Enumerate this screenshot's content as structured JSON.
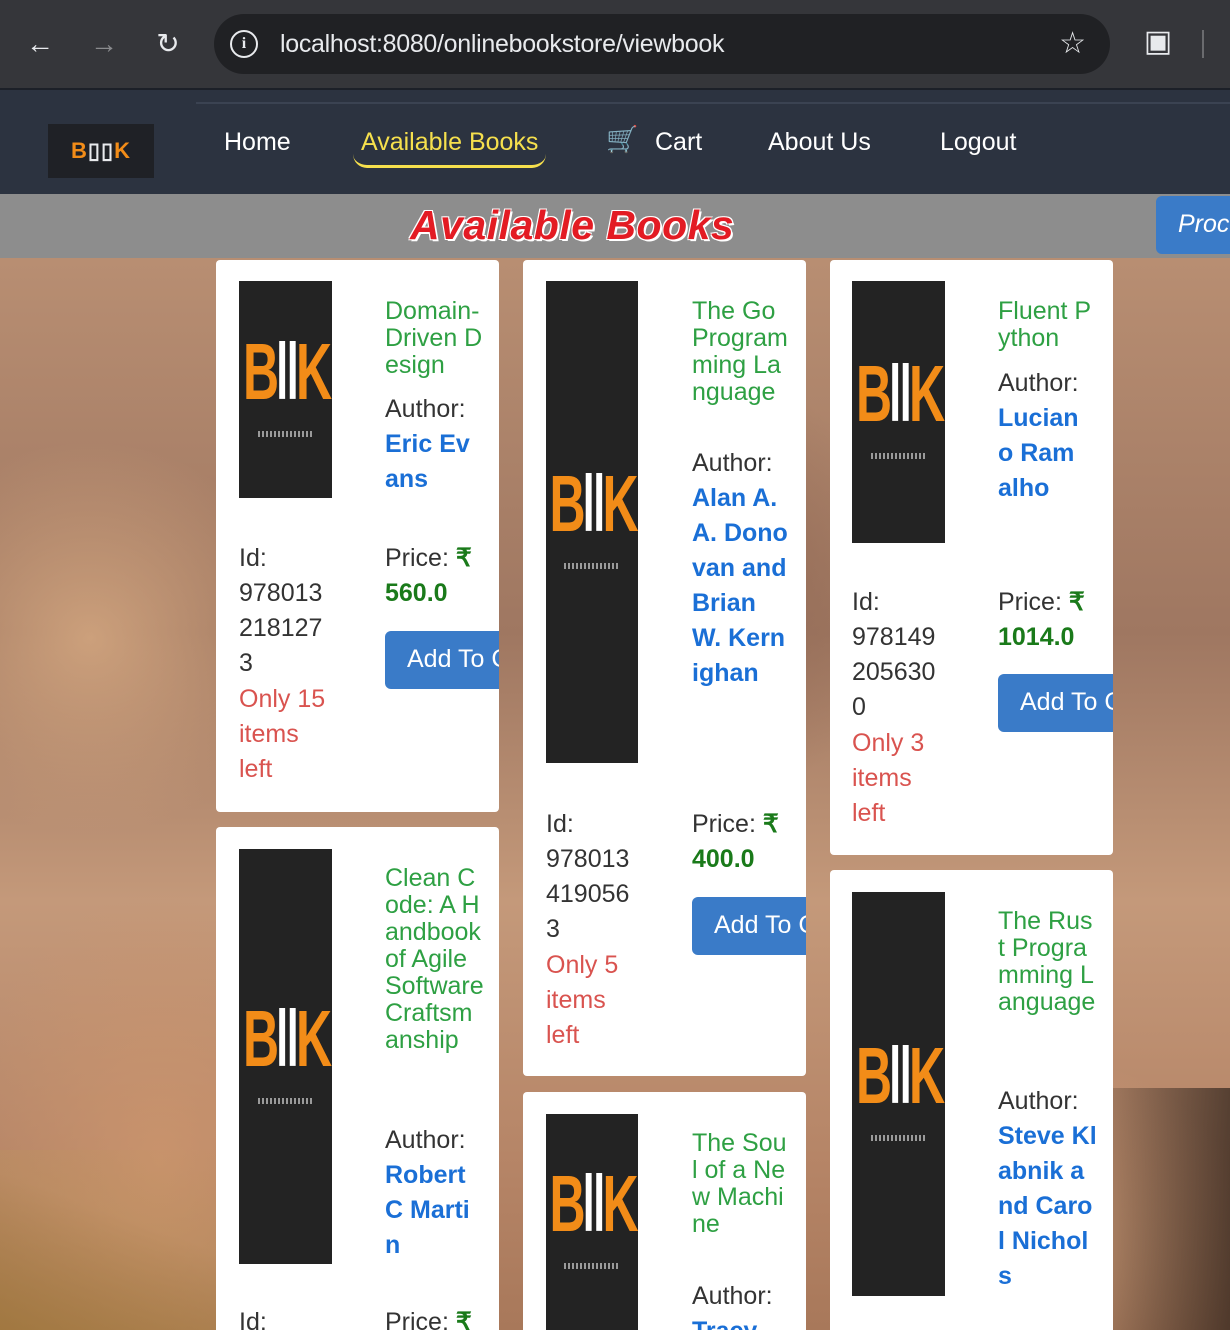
{
  "browser": {
    "url": "localhost:8080/onlinebookstore/viewbook",
    "icons": {
      "back": "arrow-left-icon",
      "forward": "arrow-right-icon",
      "reload": "reload-icon",
      "info": "info-icon",
      "bookmark": "star-icon",
      "extensions": "puzzle-icon"
    }
  },
  "navbar": {
    "logo_text": "BOOK",
    "items": [
      {
        "label": "Home"
      },
      {
        "label": "Available Books",
        "active": true
      },
      {
        "label": "Cart",
        "icon": "cart-icon"
      },
      {
        "label": "About Us"
      },
      {
        "label": "Logout"
      }
    ]
  },
  "heading": {
    "title": "Available Books",
    "proceed_label": "Proceed"
  },
  "books": [
    {
      "title": "Domain-Driven Design",
      "author_label": "Author:",
      "author": "Eric Evans",
      "id_label": "Id:",
      "id": "9780132181273",
      "stock": "Only 15 items left",
      "price_label": "Price:",
      "currency": "₹",
      "price": "560.0",
      "button": "Add To Cart"
    },
    {
      "title": "The Go Programming Language",
      "author_label": "Author:",
      "author": "Alan A. A. Donovan and Brian W. Kernighan",
      "id_label": "Id:",
      "id": "9780134190563",
      "stock": "Only 5 items left",
      "price_label": "Price:",
      "currency": "₹",
      "price": "400.0",
      "button": "Add To Cart"
    },
    {
      "title": "Fluent Python",
      "author_label": "Author:",
      "author": "Luciano Ramalho",
      "id_label": "Id:",
      "id": "9781492056300",
      "stock": "Only 3 items left",
      "price_label": "Price:",
      "currency": "₹",
      "price": "1014.0",
      "button": "Add To Cart"
    },
    {
      "title": "Clean Code: A Handbook of Agile Software Craftsmanship",
      "author_label": "Author:",
      "author": "Robert C Martin",
      "id_label": "Id:",
      "price_label": "Price:",
      "currency": "₹"
    },
    {
      "title": "The Soul of a New Machine",
      "author_label": "Author:",
      "author": "Tracy"
    },
    {
      "title": "The Rust Programming Language",
      "author_label": "Author:",
      "author": "Steve Klabnik and Carol Nichols"
    }
  ],
  "colors": {
    "title": "#2ea043",
    "author": "#1a6fd6",
    "stock": "#d9534f",
    "price": "#1a7a1a",
    "button": "#3a7bc8",
    "heading": "#e31b23",
    "active_nav": "#f6e04d"
  }
}
